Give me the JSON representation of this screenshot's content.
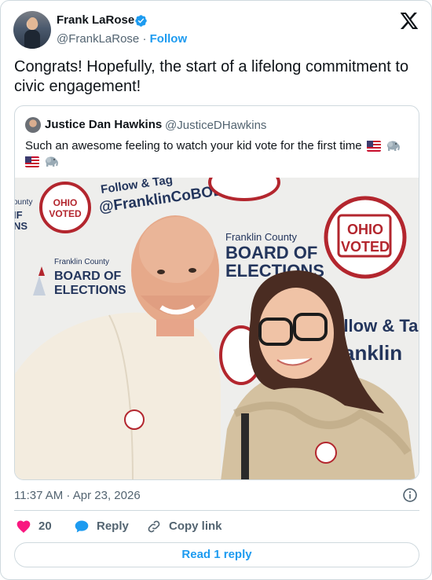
{
  "tweet": {
    "author_name": "Frank LaRose",
    "author_handle": "@FrankLaRose",
    "separator": "·",
    "follow_label": "Follow",
    "text": "Congrats! Hopefully, the start of a lifelong commitment to civic engagement!",
    "timestamp": "11:37 AM · Apr 23, 2026",
    "likes": "20",
    "reply_label": "Reply",
    "copy_label": "Copy link",
    "read_replies_label": "Read 1 reply"
  },
  "quoted": {
    "author_name": "Justice Dan Hawkins",
    "author_handle": "@JusticeDHawkins",
    "text_line1": "Such an awesome feeling to watch your kid vote for the first time",
    "photo_backdrop": {
      "follow_text": "Follow & Tag",
      "follow_handle": "@FranklinCoBOE",
      "county": "Franklin County",
      "board": "BOARD OF",
      "elections": "ELECTIONS",
      "badge_line1": "OHIO",
      "badge_line2": "VOTED",
      "follow_text_right": "ollow & Ta",
      "follow_handle_right": "anklin",
      "left_edge_line1": "ounty",
      "left_edge_line2": "IF",
      "left_edge_line3": "NS"
    }
  },
  "colors": {
    "accent": "#1d9bf0",
    "like": "#f91880",
    "muted": "#536471",
    "border": "#cfd9de",
    "badge_red": "#b3262e"
  },
  "icons": [
    "verified-badge-icon",
    "x-logo-icon",
    "info-icon",
    "heart-icon",
    "reply-bubble-icon",
    "link-icon",
    "us-flag-icon",
    "elephant-icon"
  ]
}
